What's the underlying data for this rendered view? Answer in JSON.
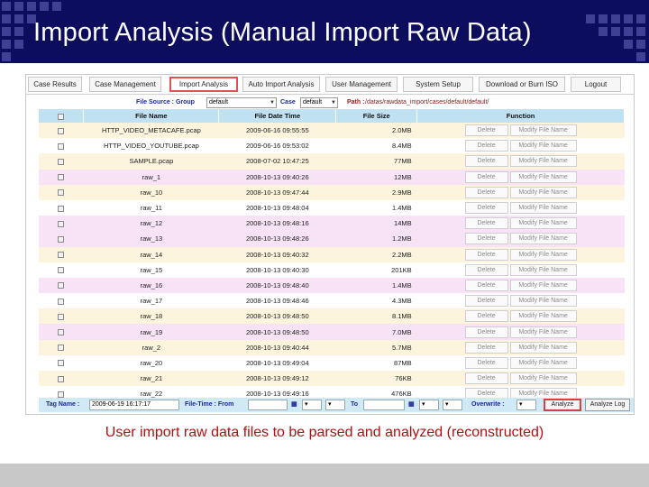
{
  "slide": {
    "title": "Import Analysis (Manual Import Raw Data)",
    "caption": "User import raw data files to be parsed and analyzed (reconstructed)"
  },
  "nav": {
    "tabs": [
      {
        "label": "Case Results"
      },
      {
        "label": "Case Management"
      },
      {
        "label": "Import Analysis",
        "active": true
      },
      {
        "label": "Auto Import Analysis"
      },
      {
        "label": "User Management"
      },
      {
        "label": "System Setup"
      },
      {
        "label": "Download or Burn ISO"
      },
      {
        "label": "Logout"
      }
    ]
  },
  "source": {
    "file_source_label": "File Source : Group",
    "group_value": "default",
    "case_label": "Case",
    "case_value": "default",
    "path_label": "Path :",
    "path_value": "/datas/rawdata_import/cases/default/default/"
  },
  "table": {
    "headers": {
      "file_name": "File Name",
      "file_date_time": "File Date Time",
      "file_size": "File Size",
      "function": "Function"
    },
    "delete_label": "Delete",
    "modify_label": "Modify File Name",
    "rows": [
      {
        "name": "HTTP_VIDEO_METACAFE.pcap",
        "datetime": "2009-06-16 09:55:55",
        "size": "2.0MB"
      },
      {
        "name": "HTTP_VIDEO_YOUTUBE.pcap",
        "datetime": "2009-06-16 09:53:02",
        "size": "8.4MB"
      },
      {
        "name": "SAMPLE.pcap",
        "datetime": "2008-07-02 10:47:25",
        "size": "77MB"
      },
      {
        "name": "raw_1",
        "datetime": "2008-10-13 09:40:26",
        "size": "12MB"
      },
      {
        "name": "raw_10",
        "datetime": "2008-10-13 09:47:44",
        "size": "2.9MB"
      },
      {
        "name": "raw_11",
        "datetime": "2008-10-13 09:48:04",
        "size": "1.4MB"
      },
      {
        "name": "raw_12",
        "datetime": "2008-10-13 09:48:16",
        "size": "14MB"
      },
      {
        "name": "raw_13",
        "datetime": "2008-10-13 09:48:26",
        "size": "1.2MB"
      },
      {
        "name": "raw_14",
        "datetime": "2008-10-13 09:40:32",
        "size": "2.2MB"
      },
      {
        "name": "raw_15",
        "datetime": "2008-10-13 09:40:30",
        "size": "201KB"
      },
      {
        "name": "raw_16",
        "datetime": "2008-10-13 09:48:40",
        "size": "1.4MB"
      },
      {
        "name": "raw_17",
        "datetime": "2008-10-13 09:48:46",
        "size": "4.3MB"
      },
      {
        "name": "raw_18",
        "datetime": "2008-10-13 09:48:50",
        "size": "8.1MB"
      },
      {
        "name": "raw_19",
        "datetime": "2008-10-13 09:48:50",
        "size": "7.0MB"
      },
      {
        "name": "raw_2",
        "datetime": "2008-10-13 09:40:44",
        "size": "5.7MB"
      },
      {
        "name": "raw_20",
        "datetime": "2008-10-13 09:49:04",
        "size": "87MB"
      },
      {
        "name": "raw_21",
        "datetime": "2008-10-13 09:49:12",
        "size": "76KB"
      },
      {
        "name": "raw_22",
        "datetime": "2008-10-13 09:49:16",
        "size": "476KB"
      }
    ]
  },
  "bottom": {
    "tag_name_label": "Tag Name :",
    "tag_name_value": "2009-06-19 16:17:17",
    "file_time_label": "File-Time : From",
    "to_label": "To",
    "overwrite_label": "Overwrite :",
    "analyze_label": "Analyze",
    "analyze_log_label": "Analyze Log"
  }
}
